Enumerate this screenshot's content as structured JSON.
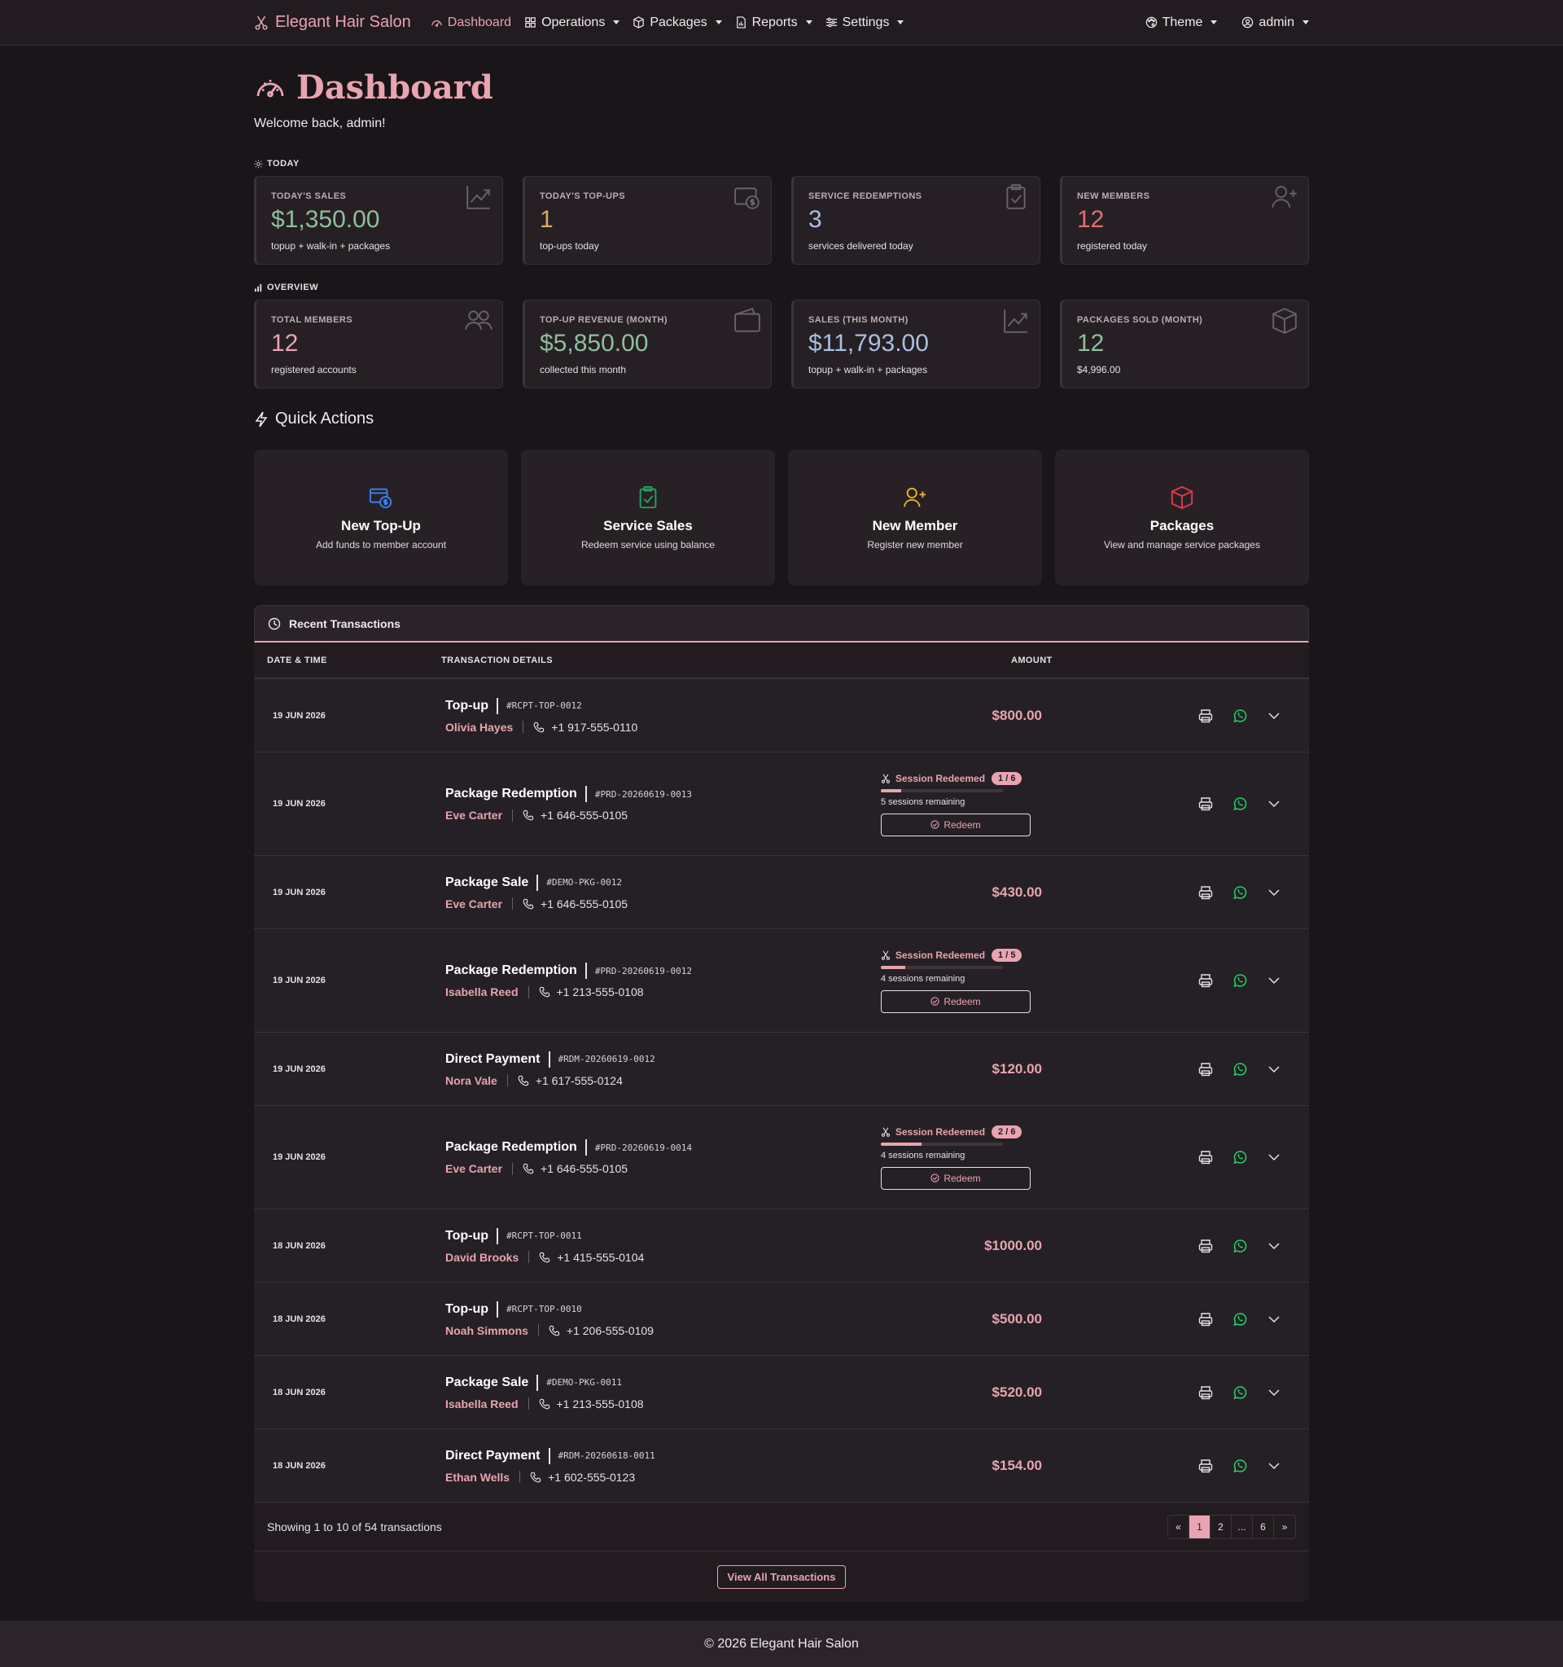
{
  "nav": {
    "brand": "Elegant Hair Salon",
    "items": [
      {
        "label": "Dashboard"
      },
      {
        "label": "Operations"
      },
      {
        "label": "Packages"
      },
      {
        "label": "Reports"
      },
      {
        "label": "Settings"
      }
    ],
    "theme": "Theme",
    "user": "admin"
  },
  "header": {
    "title": "Dashboard",
    "welcome": "Welcome back, admin!"
  },
  "today": {
    "label": "TODAY",
    "cards": [
      {
        "label": "TODAY'S SALES",
        "value": "$1,350.00",
        "sub": "topup + walk-in + packages"
      },
      {
        "label": "TODAY'S TOP-UPS",
        "value": "1",
        "sub": "top-ups today"
      },
      {
        "label": "SERVICE REDEMPTIONS",
        "value": "3",
        "sub": "services delivered today"
      },
      {
        "label": "NEW MEMBERS",
        "value": "12",
        "sub": "registered today"
      }
    ]
  },
  "overview": {
    "label": "OVERVIEW",
    "cards": [
      {
        "label": "TOTAL MEMBERS",
        "value": "12",
        "sub": "registered accounts"
      },
      {
        "label": "TOP-UP REVENUE (MONTH)",
        "value": "$5,850.00",
        "sub": "collected this month"
      },
      {
        "label": "SALES (THIS MONTH)",
        "value": "$11,793.00",
        "sub": "topup + walk-in + packages"
      },
      {
        "label": "PACKAGES SOLD (MONTH)",
        "value": "12",
        "sub": "$4,996.00"
      }
    ]
  },
  "quick_actions": {
    "title": "Quick Actions",
    "items": [
      {
        "name": "New Top-Up",
        "desc": "Add funds to member account",
        "icon": "wallet-dollar-icon",
        "color": "#3b82f6"
      },
      {
        "name": "Service Sales",
        "desc": "Redeem service using balance",
        "icon": "clipboard-check-icon",
        "color": "#22a35a"
      },
      {
        "name": "New Member",
        "desc": "Register new member",
        "icon": "person-plus-icon",
        "color": "#f0b429"
      },
      {
        "name": "Packages",
        "desc": "View and manage service packages",
        "icon": "box-icon",
        "color": "#e03a4a"
      }
    ]
  },
  "transactions": {
    "title": "Recent Transactions",
    "columns": {
      "date": "DATE & TIME",
      "details": "TRANSACTION DETAILS",
      "amount": "AMOUNT"
    },
    "rows": [
      {
        "date": "19 JUN 2026",
        "type": "Top-up",
        "ref": "#RCPT-TOP-0012",
        "name": "Olivia Hayes",
        "phone": "+1 917-555-0110",
        "amount": "$800.00"
      },
      {
        "date": "19 JUN 2026",
        "type": "Package Redemption",
        "ref": "#PRD-20260619-0013",
        "name": "Eve Carter",
        "phone": "+1 646-555-0105",
        "redeemed_label": "Session Redeemed",
        "badge": "1 / 6",
        "progress": 0.167,
        "remaining": "5 sessions remaining",
        "redeem_label": "Redeem"
      },
      {
        "date": "19 JUN 2026",
        "type": "Package Sale",
        "ref": "#DEMO-PKG-0012",
        "name": "Eve Carter",
        "phone": "+1 646-555-0105",
        "amount": "$430.00"
      },
      {
        "date": "19 JUN 2026",
        "type": "Package Redemption",
        "ref": "#PRD-20260619-0012",
        "name": "Isabella Reed",
        "phone": "+1 213-555-0108",
        "redeemed_label": "Session Redeemed",
        "badge": "1 / 5",
        "progress": 0.2,
        "remaining": "4 sessions remaining",
        "redeem_label": "Redeem"
      },
      {
        "date": "19 JUN 2026",
        "type": "Direct Payment",
        "ref": "#RDM-20260619-0012",
        "name": "Nora Vale",
        "phone": "+1 617-555-0124",
        "amount": "$120.00"
      },
      {
        "date": "19 JUN 2026",
        "type": "Package Redemption",
        "ref": "#PRD-20260619-0014",
        "name": "Eve Carter",
        "phone": "+1 646-555-0105",
        "redeemed_label": "Session Redeemed",
        "badge": "2 / 6",
        "progress": 0.333,
        "remaining": "4 sessions remaining",
        "redeem_label": "Redeem"
      },
      {
        "date": "18 JUN 2026",
        "type": "Top-up",
        "ref": "#RCPT-TOP-0011",
        "name": "David Brooks",
        "phone": "+1 415-555-0104",
        "amount": "$1000.00"
      },
      {
        "date": "18 JUN 2026",
        "type": "Top-up",
        "ref": "#RCPT-TOP-0010",
        "name": "Noah Simmons",
        "phone": "+1 206-555-0109",
        "amount": "$500.00"
      },
      {
        "date": "18 JUN 2026",
        "type": "Package Sale",
        "ref": "#DEMO-PKG-0011",
        "name": "Isabella Reed",
        "phone": "+1 213-555-0108",
        "amount": "$520.00"
      },
      {
        "date": "18 JUN 2026",
        "type": "Direct Payment",
        "ref": "#RDM-20260618-0011",
        "name": "Ethan Wells",
        "phone": "+1 602-555-0123",
        "amount": "$154.00"
      }
    ],
    "showing": "Showing 1 to 10 of 54 transactions",
    "pager": [
      "«",
      "1",
      "2",
      "...",
      "6",
      "»"
    ],
    "view_all": "View All Transactions"
  },
  "footer": "© 2026 Elegant Hair Salon",
  "colors": {
    "accent": "#e8a4b0",
    "background": "#1a1519",
    "whatsapp": "#25d366"
  }
}
